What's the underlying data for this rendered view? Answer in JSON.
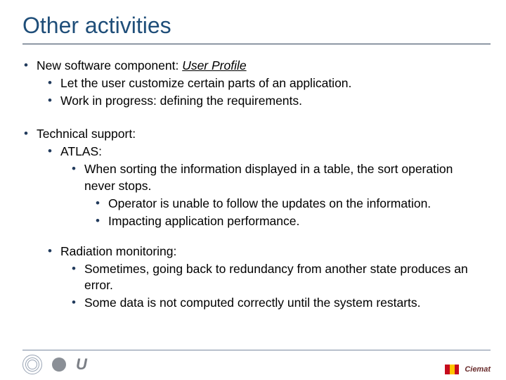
{
  "title": "Other activities",
  "sections": [
    {
      "text_before": "New software component: ",
      "emph": "User Profile",
      "children": [
        {
          "text": "Let the user customize certain parts of an application."
        },
        {
          "text": "Work in progress: defining the requirements."
        }
      ]
    },
    {
      "text": "Technical support:",
      "children": [
        {
          "text": "ATLAS:",
          "children": [
            {
              "text": "When sorting the information displayed in a table, the sort operation never stops.",
              "children": [
                {
                  "text": "Operator is unable to follow the updates on the information."
                },
                {
                  "text": "Impacting application performance."
                }
              ]
            }
          ]
        },
        {
          "text": "Radiation monitoring:",
          "children": [
            {
              "text": "Sometimes, going back to redundancy from another state produces an error."
            },
            {
              "text": "Some data is not computed correctly until the system restarts."
            }
          ]
        }
      ]
    }
  ],
  "footer": {
    "right_text": "Ciemat"
  }
}
